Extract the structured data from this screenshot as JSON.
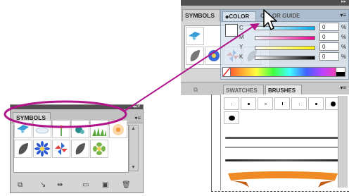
{
  "symbols_panel": {
    "tab_label": "SYMBOLS",
    "menu_icon": "panel-menu-icon",
    "scroll_up": "▲",
    "scroll_down": "▼",
    "symbols": [
      "blue-bird",
      "cloud",
      "flower-sprout",
      "teal-shapes",
      "grass",
      "orange-flower",
      "grey-leaf",
      "blue-daisy",
      "pinwheel",
      "grey-leaf-2",
      "green-tile"
    ],
    "bottom_tools": [
      "place-symbol-icon",
      "break-link-icon",
      "symbol-options-icon",
      "duplicate-icon",
      "new-symbol-icon",
      "delete-icon"
    ]
  },
  "composite_panel": {
    "symbols_tab_label": "SYMBOLS",
    "color_panel": {
      "tab_color": "COLOR",
      "tab_color_guide": "COLOR GUIDE",
      "channels": [
        {
          "label": "C",
          "value": "0",
          "unit": "%"
        },
        {
          "label": "M",
          "value": "0",
          "unit": "%"
        },
        {
          "label": "Y",
          "value": "0",
          "unit": "%"
        },
        {
          "label": "K",
          "value": "0",
          "unit": "%"
        }
      ]
    },
    "tab_swatches": "SWATCHES",
    "tab_brushes": "BRUSHES"
  },
  "colors": {
    "highlight_ellipse": "#b0168a",
    "panel_grey": "#d5d5d5",
    "dark_bar": "#505050",
    "brush_orange": "#f08a24"
  }
}
